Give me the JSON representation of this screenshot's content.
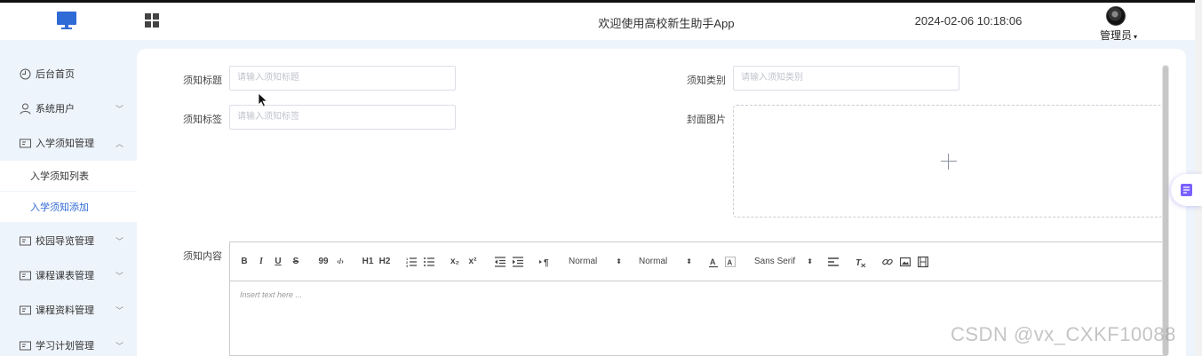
{
  "header": {
    "logo_icon": "monitor-icon",
    "menu_icon": "grid-icon",
    "welcome": "欢迎使用高校新生助手App",
    "datetime": "2024-02-06 10:18:06",
    "user": "管理员",
    "accent": "#2f6bd6"
  },
  "sidebar": {
    "items": [
      {
        "label": "后台首页",
        "icon": "clock-icon"
      },
      {
        "label": "系统用户",
        "icon": "user-icon"
      },
      {
        "label": "入学须知管理",
        "icon": "card-icon"
      },
      {
        "label": "校园导览管理",
        "icon": "card-icon"
      },
      {
        "label": "课程课表管理",
        "icon": "card-icon"
      },
      {
        "label": "课程资料管理",
        "icon": "card-icon"
      },
      {
        "label": "学习计划管理",
        "icon": "card-icon"
      }
    ],
    "subitems": [
      {
        "label": "入学须知列表",
        "active": false
      },
      {
        "label": "入学须知添加",
        "active": true
      }
    ]
  },
  "form": {
    "title_label": "须知标题",
    "title_placeholder": "请输入须知标题",
    "category_label": "须知类别",
    "category_placeholder": "请输入须知类别",
    "tag_label": "须知标签",
    "tag_placeholder": "请输入须知标签",
    "cover_label": "封面图片",
    "content_label": "须知内容"
  },
  "editor": {
    "toolbar": {
      "bold": "B",
      "italic": "I",
      "underline": "U",
      "strike": "S",
      "quote": "99",
      "code": "‹/›",
      "h1": "H1",
      "h2": "H2",
      "sub": "x₂",
      "sup": "x²",
      "size_value": "Normal",
      "header_value": "Normal",
      "font_value": "Sans Serif"
    },
    "placeholder": "Insert text here ..."
  },
  "watermark": "CSDN @vx_CXKF10088"
}
